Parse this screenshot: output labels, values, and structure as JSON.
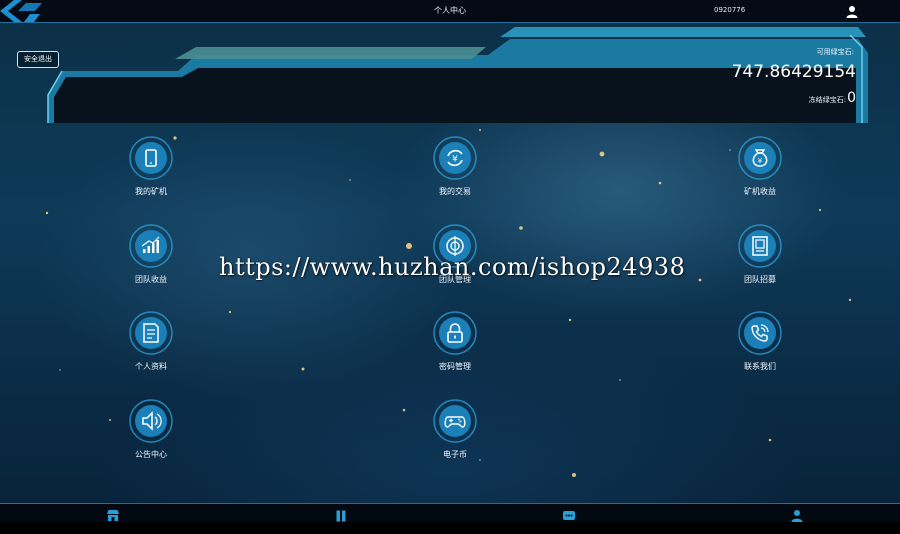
{
  "header": {
    "title": "个人中心",
    "user_id": "0920776"
  },
  "panel": {
    "logout_label": "安全退出",
    "available_label": "可用绿宝石:",
    "available_value": "747.86429154",
    "frozen_label": "冻结绿宝石:",
    "frozen_value": "0"
  },
  "menu": {
    "items": [
      {
        "label": "我的矿机",
        "icon": "phone-icon"
      },
      {
        "label": "我的交易",
        "icon": "exchange-icon"
      },
      {
        "label": "矿机收益",
        "icon": "money-bag-icon"
      },
      {
        "label": "团队收益",
        "icon": "growth-chart-icon"
      },
      {
        "label": "团队管理",
        "icon": "target-icon"
      },
      {
        "label": "团队招募",
        "icon": "recruit-icon"
      },
      {
        "label": "个人资料",
        "icon": "document-icon"
      },
      {
        "label": "密码管理",
        "icon": "lock-icon"
      },
      {
        "label": "联系我们",
        "icon": "phone-call-icon"
      },
      {
        "label": "公告中心",
        "icon": "speaker-icon"
      },
      {
        "label": "电子币",
        "icon": "gamepad-icon"
      }
    ]
  },
  "watermark": "https://www.huzhan.com/ishop24938",
  "bottom_nav": {
    "tabs": [
      {
        "icon": "shop-icon"
      },
      {
        "icon": "pause-icon"
      },
      {
        "icon": "chat-icon"
      },
      {
        "icon": "user-icon"
      }
    ]
  },
  "colors": {
    "accent": "#2a9fd6",
    "panel_teal": "#3f8f9a"
  }
}
